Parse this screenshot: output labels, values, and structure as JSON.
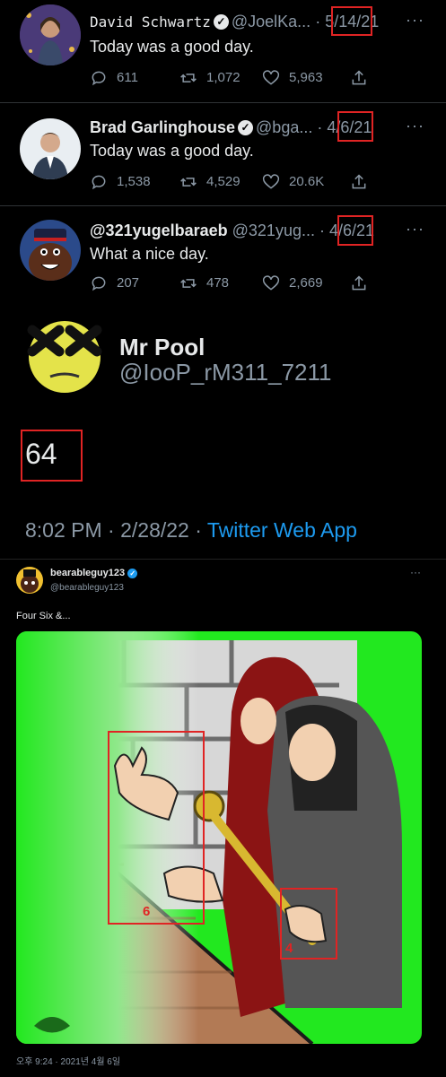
{
  "tweets": [
    {
      "name": "David Schwartz",
      "handle": "@JoelKa...",
      "sep": "·",
      "date": "5/14/21",
      "text": "Today was a good day.",
      "replies": "611",
      "retweets": "1,072",
      "likes": "5,963"
    },
    {
      "name": "Brad Garlinghouse",
      "handle": "@bga...",
      "sep": "·",
      "date": "4/6/21",
      "text": "Today was a good day.",
      "replies": "1,538",
      "retweets": "4,529",
      "likes": "20.6K"
    },
    {
      "name": "@321yugelbaraeb",
      "handle": "@321yug...",
      "sep": "·",
      "date": "4/6/21",
      "text": "What a nice day.",
      "replies": "207",
      "retweets": "478",
      "likes": "2,669"
    }
  ],
  "more_label": "···",
  "profile": {
    "name": "Mr Pool",
    "handle": "@IooP_rM311_7211"
  },
  "main_text": "64",
  "meta": {
    "time_date": "8:02 PM · 2/28/22 · ",
    "source": "Twitter Web App"
  },
  "embed": {
    "name": "bearableguy123",
    "handle": "@bearableguy123",
    "text": "Four Six &...",
    "timestamp": "오후 9:24 · 2021년 4월 6일",
    "annotations": [
      "6",
      "4"
    ]
  },
  "colors": {
    "accent": "#1d9bf0",
    "highlight": "#e02424",
    "background": "#000000"
  },
  "icons": [
    "reply-icon",
    "retweet-icon",
    "like-icon",
    "share-icon",
    "verified-icon",
    "more-icon"
  ]
}
